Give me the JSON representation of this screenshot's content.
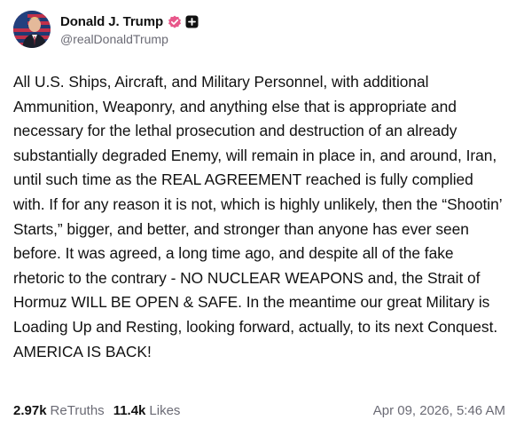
{
  "author": {
    "display_name": "Donald J. Trump",
    "handle": "@realDonaldTrump",
    "verified_badge_icon": "verified-check-icon",
    "extra_badge_icon": "plus-square-icon",
    "verified_color": "#e8578a"
  },
  "post": {
    "text": "All U.S. Ships, Aircraft, and Military Personnel, with additional Ammunition, Weaponry, and anything else that is appropriate and necessary for the lethal prosecution and destruction of an already substantially degraded Enemy, will remain in place in, and around, Iran, until such time as the REAL AGREEMENT reached is fully complied with. If for any reason it is not, which is highly unlikely, then the “Shootin’ Starts,” bigger, and better, and stronger than anyone has ever seen before. It was agreed, a long time ago, and despite all of the fake rhetoric to the contrary - NO NUCLEAR WEAPONS and, the Strait of Hormuz WILL BE OPEN & SAFE. In the meantime our great Military is Loading Up and Resting, looking forward, actually, to its next Conquest. AMERICA IS BACK!"
  },
  "stats": {
    "retruths_count": "2.97k",
    "retruths_label": "ReTruths",
    "likes_count": "11.4k",
    "likes_label": "Likes"
  },
  "timestamp": "Apr 09, 2026, 5:46 AM"
}
